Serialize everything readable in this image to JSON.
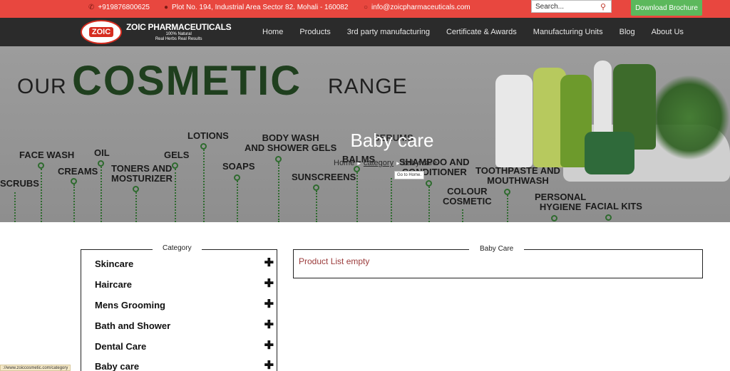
{
  "topbar": {
    "phone": "+919876800625",
    "address": "Plot No. 194, Industrial Area Sector 82. Mohali - 160082",
    "email": "info@zoicpharmaceuticals.com",
    "search_placeholder": "Search...",
    "download_label": "Download Brochure",
    "phone_icon": "phone-icon",
    "address_icon": "map-pin-icon",
    "email_icon": "chat-icon",
    "search_icon": "search-icon"
  },
  "brand": {
    "badge": "ZOIC",
    "name": "ZOIC PHARMACEUTICALS",
    "tagline1": "100% Natural",
    "tagline2": "Real Herbs Real Results"
  },
  "nav": {
    "items": [
      "Home",
      "Products",
      "3rd party manufacturing",
      "Certificate & Awards",
      "Manufacturing Units",
      "Blog",
      "About Us"
    ]
  },
  "hero": {
    "our": "OUR",
    "cosmetic": "COSMETIC",
    "range": "RANGE",
    "labels": {
      "scrubs": "SCRUBS",
      "face_wash": "FACE WASH",
      "creams": "CREAMS",
      "oil": "OIL",
      "toners": "TONERS AND\nMOSTURIZER",
      "gels": "GELS",
      "lotions": "LOTIONS",
      "soaps": "SOAPS",
      "body_wash": "BODY WASH\nAND SHOWER GELS",
      "sunscreens": "SUNSCREENS",
      "balms": "BALMS",
      "serums": "SERUMS",
      "shampoo": "SHAMPOO AND\nCONDITIONER",
      "colour": "COLOUR\nCOSMETIC",
      "toothpaste": "TOOTHPASTE AND\nMOUTHWASH",
      "personal": "PERSONAL\nHYGIENE",
      "facial": "FACIAL KITS"
    },
    "page_title": "Baby care",
    "breadcrumb": {
      "home": "Home",
      "category": "category",
      "current": "baby care"
    },
    "tooltip": "Go to Home."
  },
  "sidebar": {
    "legend": "Category",
    "items": [
      "Skincare",
      "Haircare",
      "Mens Grooming",
      "Bath and Shower",
      "Dental Care",
      "Baby care"
    ]
  },
  "main": {
    "legend": "Baby Care",
    "empty_message": "Product List empty"
  },
  "status": {
    "url": "://www.zoiccosmetic.com/category"
  },
  "colors": {
    "accent_red": "#e8473f",
    "nav_dark": "#2b2b2b",
    "download_green": "#5cb85c",
    "cosmetic_green": "#1f3f1e"
  }
}
